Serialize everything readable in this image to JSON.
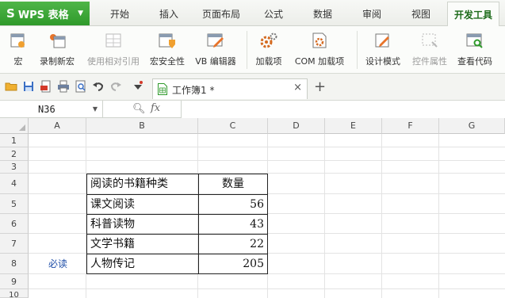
{
  "app": {
    "name": "WPS 表格"
  },
  "menu_tabs": [
    {
      "label": "开始"
    },
    {
      "label": "插入"
    },
    {
      "label": "页面布局"
    },
    {
      "label": "公式"
    },
    {
      "label": "数据"
    },
    {
      "label": "审阅"
    },
    {
      "label": "视图"
    },
    {
      "label": "开发工具"
    }
  ],
  "active_menu_tab": "开发工具",
  "ribbon": {
    "macro": "宏",
    "record_macro": "录制新宏",
    "relative_ref": "使用相对引用",
    "macro_security": "宏安全性",
    "vb_editor": "VB 编辑器",
    "addins": "加载项",
    "com_addins": "COM 加载项",
    "design_mode": "设计模式",
    "control_props": "控件属性",
    "view_code": "查看代码"
  },
  "document_tab": {
    "name": "工作簿1 *"
  },
  "formula_bar": {
    "name_box": "N36",
    "fx_label": "fx",
    "formula": ""
  },
  "columns": [
    "A",
    "B",
    "C",
    "D",
    "E",
    "F",
    "G"
  ],
  "rows": [
    "1",
    "2",
    "3",
    "4",
    "5",
    "6",
    "7",
    "8",
    "9",
    "10"
  ],
  "table": {
    "header": {
      "category": "阅读的书籍种类",
      "count": "数量"
    },
    "rows": [
      {
        "category": "课文阅读",
        "count": "56"
      },
      {
        "category": "科普读物",
        "count": "43"
      },
      {
        "category": "文学书籍",
        "count": "22"
      },
      {
        "category": "人物传记",
        "count": "205"
      }
    ]
  },
  "annotation": {
    "a8": "必读"
  },
  "colors": {
    "accent": "#2f9a2b",
    "active_tab_text": "#1d6b1a",
    "annotation_text": "#1f4ea8"
  }
}
